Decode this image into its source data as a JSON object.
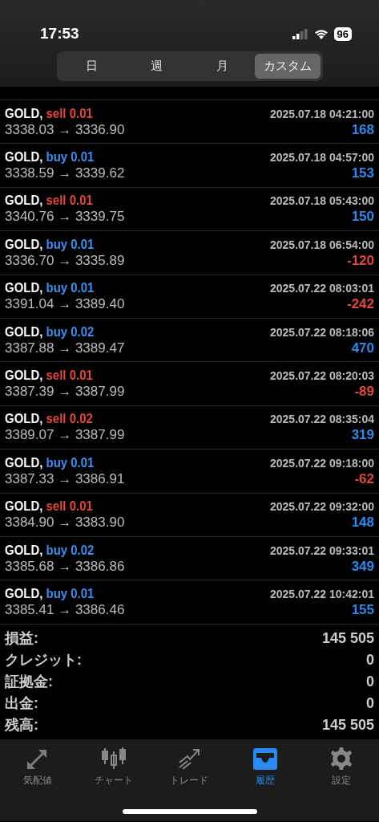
{
  "status_bar": {
    "time": "17:53",
    "battery": "96"
  },
  "period_tabs": [
    {
      "label": "日",
      "selected": false
    },
    {
      "label": "週",
      "selected": false
    },
    {
      "label": "月",
      "selected": false
    },
    {
      "label": "カスタム",
      "selected": true
    }
  ],
  "deals": [
    {
      "symbol": "GOLD,",
      "side": {
        "label": "sell 0.01",
        "color": "#e8453c"
      },
      "time": "2025.07.18 04:21:00",
      "prices": "3338.03 → 3336.90",
      "profit": {
        "text": "168",
        "color": "#2a8af0"
      }
    },
    {
      "symbol": "GOLD,",
      "side": {
        "label": "buy 0.01",
        "color": "#3a8ff0"
      },
      "time": "2025.07.18 04:57:00",
      "prices": "3338.59 → 3339.62",
      "profit": {
        "text": "153",
        "color": "#2a8af0"
      }
    },
    {
      "symbol": "GOLD,",
      "side": {
        "label": "sell 0.01",
        "color": "#e8453c"
      },
      "time": "2025.07.18 05:43:00",
      "prices": "3340.76 → 3339.75",
      "profit": {
        "text": "150",
        "color": "#2a8af0"
      }
    },
    {
      "symbol": "GOLD,",
      "side": {
        "label": "buy 0.01",
        "color": "#3a8ff0"
      },
      "time": "2025.07.18 06:54:00",
      "prices": "3336.70 → 3335.89",
      "profit": {
        "text": "-120",
        "color": "#e8453c"
      }
    },
    {
      "symbol": "GOLD,",
      "side": {
        "label": "buy 0.01",
        "color": "#3a8ff0"
      },
      "time": "2025.07.22 08:03:01",
      "prices": "3391.04 → 3389.40",
      "profit": {
        "text": "-242",
        "color": "#e8453c"
      }
    },
    {
      "symbol": "GOLD,",
      "side": {
        "label": "buy 0.02",
        "color": "#3a8ff0"
      },
      "time": "2025.07.22 08:18:06",
      "prices": "3387.88 → 3389.47",
      "profit": {
        "text": "470",
        "color": "#2a8af0"
      }
    },
    {
      "symbol": "GOLD,",
      "side": {
        "label": "sell 0.01",
        "color": "#e8453c"
      },
      "time": "2025.07.22 08:20:03",
      "prices": "3387.39 → 3387.99",
      "profit": {
        "text": "-89",
        "color": "#e8453c"
      }
    },
    {
      "symbol": "GOLD,",
      "side": {
        "label": "sell 0.02",
        "color": "#e8453c"
      },
      "time": "2025.07.22 08:35:04",
      "prices": "3389.07 → 3387.99",
      "profit": {
        "text": "319",
        "color": "#2a8af0"
      }
    },
    {
      "symbol": "GOLD,",
      "side": {
        "label": "buy 0.01",
        "color": "#3a8ff0"
      },
      "time": "2025.07.22 09:18:00",
      "prices": "3387.33 → 3386.91",
      "profit": {
        "text": "-62",
        "color": "#e8453c"
      }
    },
    {
      "symbol": "GOLD,",
      "side": {
        "label": "sell 0.01",
        "color": "#e8453c"
      },
      "time": "2025.07.22 09:32:00",
      "prices": "3384.90 → 3383.90",
      "profit": {
        "text": "148",
        "color": "#2a8af0"
      }
    },
    {
      "symbol": "GOLD,",
      "side": {
        "label": "buy 0.02",
        "color": "#3a8ff0"
      },
      "time": "2025.07.22 09:33:01",
      "prices": "3385.68 → 3386.86",
      "profit": {
        "text": "349",
        "color": "#2a8af0"
      }
    },
    {
      "symbol": "GOLD,",
      "side": {
        "label": "buy 0.01",
        "color": "#3a8ff0"
      },
      "time": "2025.07.22 10:42:01",
      "prices": "3385.41 → 3386.46",
      "profit": {
        "text": "155",
        "color": "#2a8af0"
      }
    }
  ],
  "summary": [
    {
      "label": "損益:",
      "value": "145 505"
    },
    {
      "label": "クレジット:",
      "value": "0"
    },
    {
      "label": "証拠金:",
      "value": "0"
    },
    {
      "label": "出金:",
      "value": "0"
    },
    {
      "label": "残高:",
      "value": "145 505"
    }
  ],
  "tab_bar": [
    {
      "kind": "quotes",
      "label": "気配値",
      "selected": false
    },
    {
      "kind": "chart",
      "label": "チャート",
      "selected": false
    },
    {
      "kind": "trade",
      "label": "トレード",
      "selected": false
    },
    {
      "kind": "history",
      "label": "履歴",
      "selected": true
    },
    {
      "kind": "settings",
      "label": "設定",
      "selected": false
    }
  ]
}
